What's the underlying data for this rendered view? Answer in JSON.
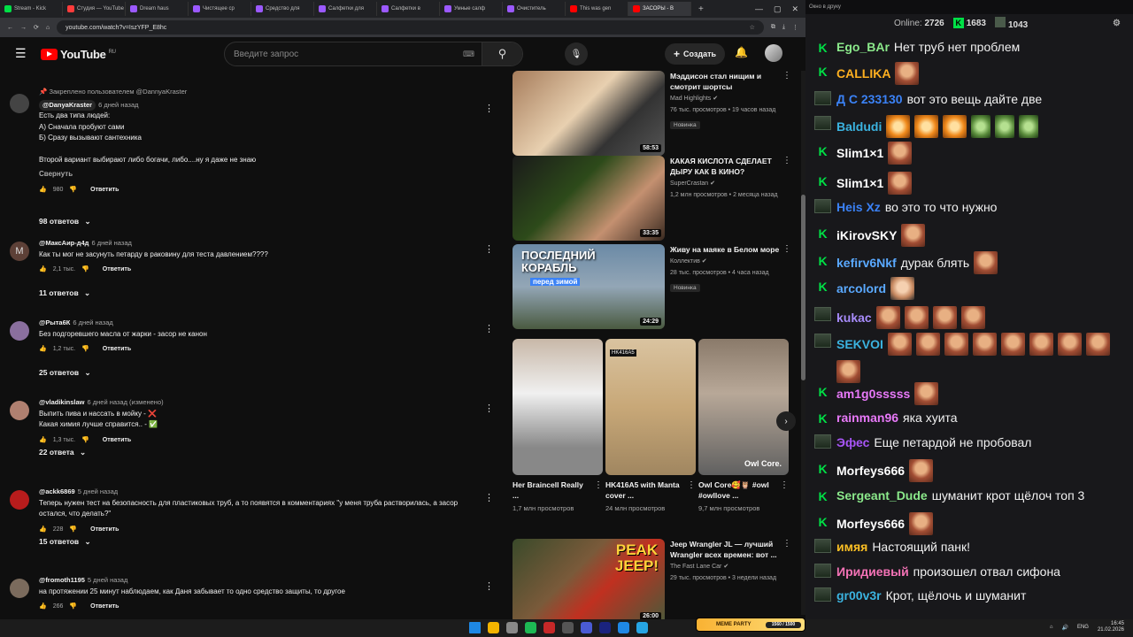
{
  "browser": {
    "tabs": [
      {
        "label": "Stream - Kick",
        "color": "#00e046"
      },
      {
        "label": "Студия — YouTube",
        "color": "#ff3b3b"
      },
      {
        "label": "Dream haus",
        "color": "#9b59ff"
      },
      {
        "label": "Чистящее ср",
        "color": "#9b59ff"
      },
      {
        "label": "Средство для",
        "color": "#9b59ff"
      },
      {
        "label": "Салфетки для",
        "color": "#9b59ff"
      },
      {
        "label": "Салфетки в",
        "color": "#9b59ff"
      },
      {
        "label": "Умные салф",
        "color": "#9b59ff"
      },
      {
        "label": "Очиститель",
        "color": "#9b59ff"
      },
      {
        "label": "This was gen",
        "color": "#ff0000"
      },
      {
        "label": "ЗАСОРЫ - В",
        "color": "#ff0000",
        "active": true
      }
    ],
    "new_tab": "+",
    "url": "youtube.com/watch?v=IszYFP_E8hc",
    "win_min": "—",
    "win_max": "▢",
    "win_close": "✕"
  },
  "youtube": {
    "logo_text": "YouTube",
    "region": "RU",
    "search_placeholder": "Введите запрос",
    "create_label": "Создать"
  },
  "comments": [
    {
      "pinned": "Закреплено пользователем @DannyaKraster",
      "author": "@DanyaKraster",
      "time": "6 дней назад",
      "lines": [
        "Есть два типа людей:",
        "А) Сначала пробуют сами",
        "Б) Сразу вызывают сантехника",
        "",
        "Второй вариант выбирают либо богачи, либо....ну я даже не знаю"
      ],
      "collapse": "Свернуть",
      "likes": "980",
      "reply": "Ответить",
      "replies": "98 ответов",
      "avatar": "#444"
    },
    {
      "author": "@МаксАир-д4д",
      "time": "6 дней назад",
      "lines": [
        "Как ты мог не засунуть петарду в раковину для теста давлением????"
      ],
      "likes": "2,1 тыс.",
      "reply": "Ответить",
      "replies": "11 ответов",
      "avatar_letter": "М",
      "avatar": "#5d4037"
    },
    {
      "author": "@Рыта6К",
      "time": "6 дней назад",
      "lines": [
        "Без подгоревшего масла от жарки - засор не канон"
      ],
      "likes": "1,2 тыс.",
      "reply": "Ответить",
      "replies": "25 ответов",
      "avatar": "#8a6f9e"
    },
    {
      "author": "@vladikinslaw",
      "time": "6 дней назад (изменено)",
      "lines": [
        "Выпить пива и нассать в мойку - ❌",
        "Какая химия лучше справится.. - ✅"
      ],
      "likes": "1,3 тыс.",
      "reply": "Ответить",
      "replies": "22 ответа",
      "avatar": "#b08070"
    },
    {
      "author": "@ackk6869",
      "time": "5 дней назад",
      "lines": [
        "Теперь нужен тест на безопасность для пластиковых труб, а то появятся в комментариях \"у меня труба растворилась, а засор остался, что делать?\""
      ],
      "likes": "228",
      "reply": "Ответить",
      "replies": "15 ответов",
      "avatar": "#b71c1c"
    },
    {
      "author": "@fromoth1195",
      "time": "5 дней назад",
      "lines": [
        "на протяжении 25 минут наблюдаем, как Даня забывает то одно средство защиты, то другое"
      ],
      "likes": "266",
      "reply": "Ответить",
      "avatar": "#7b6b5d"
    }
  ],
  "sidebar": {
    "videos": [
      {
        "title": "Мэддисон стал нищим и смотрит шортсы",
        "channel": "Mad Highlights",
        "meta": "76 тыс. просмотров • 19 часов назад",
        "badge": "Новинка",
        "duration": "58:53"
      },
      {
        "title": "КАКАЯ КИСЛОТА СДЕЛАЕТ ДЫРУ КАК В КИНО?",
        "channel": "SuperCrastan",
        "meta": "1,2 млн просмотров • 2 месяца назад",
        "duration": "33:35"
      },
      {
        "title": "Живу на маяке в Белом море",
        "channel": "Коллектив",
        "meta": "28 тыс. просмотров • 4 часа назад",
        "badge": "Новинка",
        "duration": "24:29",
        "overlay1": "ПОСЛЕДНИЙ КОРАБЛЬ",
        "overlay2": "перед зимой"
      }
    ],
    "shorts": [
      {
        "title": "Her Braincell Really ...",
        "views": "1,7 млн просмотров"
      },
      {
        "title": "HK416A5 with Manta cover ...",
        "views": "24 млн просмотров",
        "label": "HK416A5"
      },
      {
        "title": "Owl Core🥰🦉 #owl #owllove ...",
        "views": "9,7 млн просмотров",
        "label": "Owl Core."
      }
    ],
    "last_video": {
      "title": "Jeep Wrangler JL — лучший Wrangler всех времен: вот ...",
      "channel": "The Fast Lane Car",
      "meta": "29 тыс. просмотров • 3 недели назад",
      "duration": "26:00",
      "overlay": "PEAK JEEP!"
    }
  },
  "chat": {
    "header": "Окно в друку",
    "online_label": "Online:",
    "online": "2726",
    "stat1": "1683",
    "stat2": "1043",
    "messages": [
      {
        "icon": "k",
        "user": "Ego_BAr",
        "color": "#8be98b",
        "text": "Нет труб нет проблем"
      },
      {
        "icon": "k",
        "user": "CALLIKA",
        "color": "#ffb020",
        "emotes": [
          "emo"
        ]
      },
      {
        "icon": "s",
        "user": "Д С 233130",
        "color": "#3b82f6",
        "text": "вот это вещь дайте две"
      },
      {
        "icon": "s",
        "user": "Baldudi",
        "color": "#3bb3e0",
        "emotes": [
          "tiger",
          "tiger",
          "tiger",
          "frog",
          "frog",
          "frog"
        ]
      },
      {
        "icon": "k",
        "user": "Slim1×1",
        "color": "#ffffff",
        "emotes": [
          "emo"
        ]
      },
      {
        "icon": "k",
        "user": "Slim1×1",
        "color": "#ffffff",
        "emotes": [
          "emo"
        ]
      },
      {
        "icon": "s",
        "user": "Heis Xz",
        "color": "#3b82f6",
        "text": "во это то что нужно"
      },
      {
        "icon": "k",
        "user": "iKirovSKY",
        "color": "#ffffff",
        "emotes": [
          "emo"
        ]
      },
      {
        "icon": "k",
        "user": "kefirv6Nkf",
        "color": "#5aa9ff",
        "text": "дурак блять",
        "emotes": [
          "emo"
        ]
      },
      {
        "icon": "k",
        "user": "arcolord",
        "color": "#5aa9ff",
        "emotes": [
          "face"
        ]
      },
      {
        "icon": "s",
        "user": "kukac",
        "color": "#a78bfa",
        "emotes": [
          "emo",
          "emo",
          "emo",
          "emo"
        ]
      },
      {
        "icon": "s",
        "user": "SEKVOI",
        "color": "#3bb3e0",
        "emotes": [
          "emo",
          "emo",
          "emo",
          "emo",
          "emo",
          "emo",
          "emo",
          "emo",
          "emo"
        ]
      },
      {
        "icon": "k",
        "user": "am1g0sssss",
        "color": "#e879f9",
        "emotes": [
          "emo"
        ]
      },
      {
        "icon": "k",
        "user": "rainman96",
        "color": "#e879f9",
        "text": "яка хуита"
      },
      {
        "icon": "s",
        "user": "Эфес",
        "color": "#a855f7",
        "text": "Еще петардой не пробовал"
      },
      {
        "icon": "k",
        "user": "Morfeys666",
        "color": "#ffffff",
        "emotes": [
          "emo"
        ]
      },
      {
        "icon": "k",
        "user": "Sergeant_Dude",
        "color": "#8be98b",
        "text": "шуманит крот щёлоч топ 3"
      },
      {
        "icon": "k",
        "user": "Morfeys666",
        "color": "#ffffff",
        "emotes": [
          "emo"
        ]
      },
      {
        "icon": "s",
        "user": "имяя",
        "color": "#fbbf24",
        "text": "Настоящий панк!"
      },
      {
        "icon": "s",
        "user": "Иридиевый",
        "color": "#f472b6",
        "text": "произошел отвал сифона"
      },
      {
        "icon": "s",
        "user": "gr00v3r",
        "color": "#3bb3e0",
        "text": "Крот, щёлочь и шуманит"
      }
    ]
  },
  "taskbar": {
    "meme_title": "MEME PARTY",
    "meme_progress": "1560 / 1500",
    "lang": "ENG",
    "time": "16:45",
    "date": "21.02.2026"
  }
}
